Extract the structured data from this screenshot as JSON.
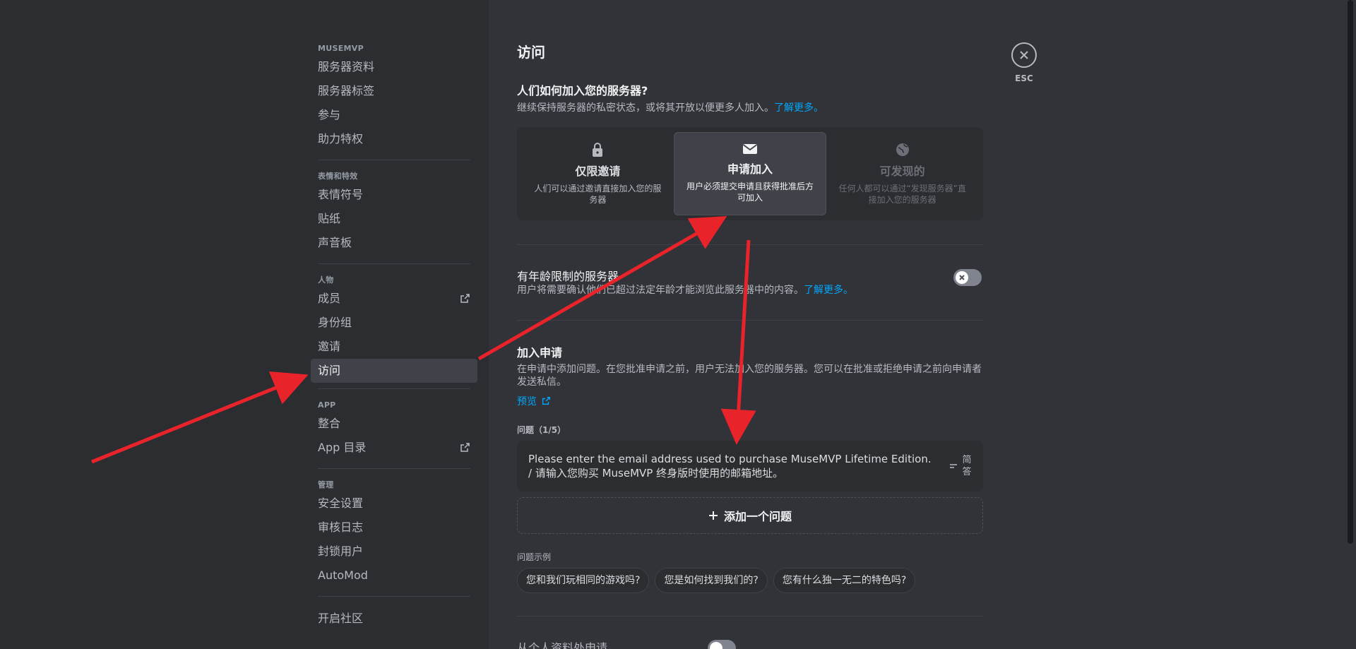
{
  "sidebar": {
    "sections": [
      {
        "title": "MUSEMVP",
        "items": [
          {
            "label": "服务器资料"
          },
          {
            "label": "服务器标签"
          },
          {
            "label": "参与"
          },
          {
            "label": "助力特权"
          }
        ]
      },
      {
        "title": "表情和特效",
        "items": [
          {
            "label": "表情符号"
          },
          {
            "label": "贴纸"
          },
          {
            "label": "声音板"
          }
        ]
      },
      {
        "title": "人物",
        "items": [
          {
            "label": "成员"
          },
          {
            "label": "身份组"
          },
          {
            "label": "邀请"
          },
          {
            "label": "访问"
          }
        ]
      },
      {
        "title": "APP",
        "items": [
          {
            "label": "整合"
          },
          {
            "label": "App 目录"
          }
        ]
      },
      {
        "title": "管理",
        "items": [
          {
            "label": "安全设置"
          },
          {
            "label": "审核日志"
          },
          {
            "label": "封锁用户"
          },
          {
            "label": "AutoMod"
          }
        ]
      },
      {
        "title": "",
        "items": [
          {
            "label": "开启社区"
          }
        ]
      }
    ]
  },
  "main": {
    "title": "访问",
    "join_heading": "人们如何加入您的服务器?",
    "join_desc": "继续保持服务器的私密状态，或将其开放以便更多人加入。",
    "learn_more": "了解更多。",
    "options": [
      {
        "title": "仅限邀请",
        "desc": "人们可以通过邀请直接加入您的服务器",
        "icon": "lock-icon"
      },
      {
        "title": "申请加入",
        "desc": "用户必须提交申请且获得批准后方可加入",
        "icon": "envelope-icon"
      },
      {
        "title": "可发现的",
        "desc": "任何人都可以通过“发现服务器”直接加入您的服务器",
        "icon": "globe-icon"
      }
    ],
    "age_title": "有年龄限制的服务器",
    "age_desc": "用户将需要确认他们已超过法定年龄才能浏览此服务器中的内容。",
    "apply_title": "加入申请",
    "apply_desc": "在申请中添加问题。在您批准申请之前，用户无法加入您的服务器。您可以在批准或拒绝申请之前向申请者发送私信。",
    "preview": "预览",
    "questions_label": "问题（1/5）",
    "question_text": "Please enter the email address used to purchase MuseMVP Lifetime Edition. / 请输入您购买 MuseMVP 终身版时使用的邮箱地址。",
    "question_type": "简答",
    "add_question": "添加一个问题",
    "examples_label": "问题示例",
    "examples": [
      "您和我们玩相同的游戏吗?",
      "您是如何找到我们的?",
      "您有什么独一无二的特色吗?"
    ],
    "partial_bottom": "从个人资料处申请"
  },
  "esc_label": "ESC",
  "colors": {
    "accent": "#00a8fc",
    "arrow": "#e8232a"
  }
}
